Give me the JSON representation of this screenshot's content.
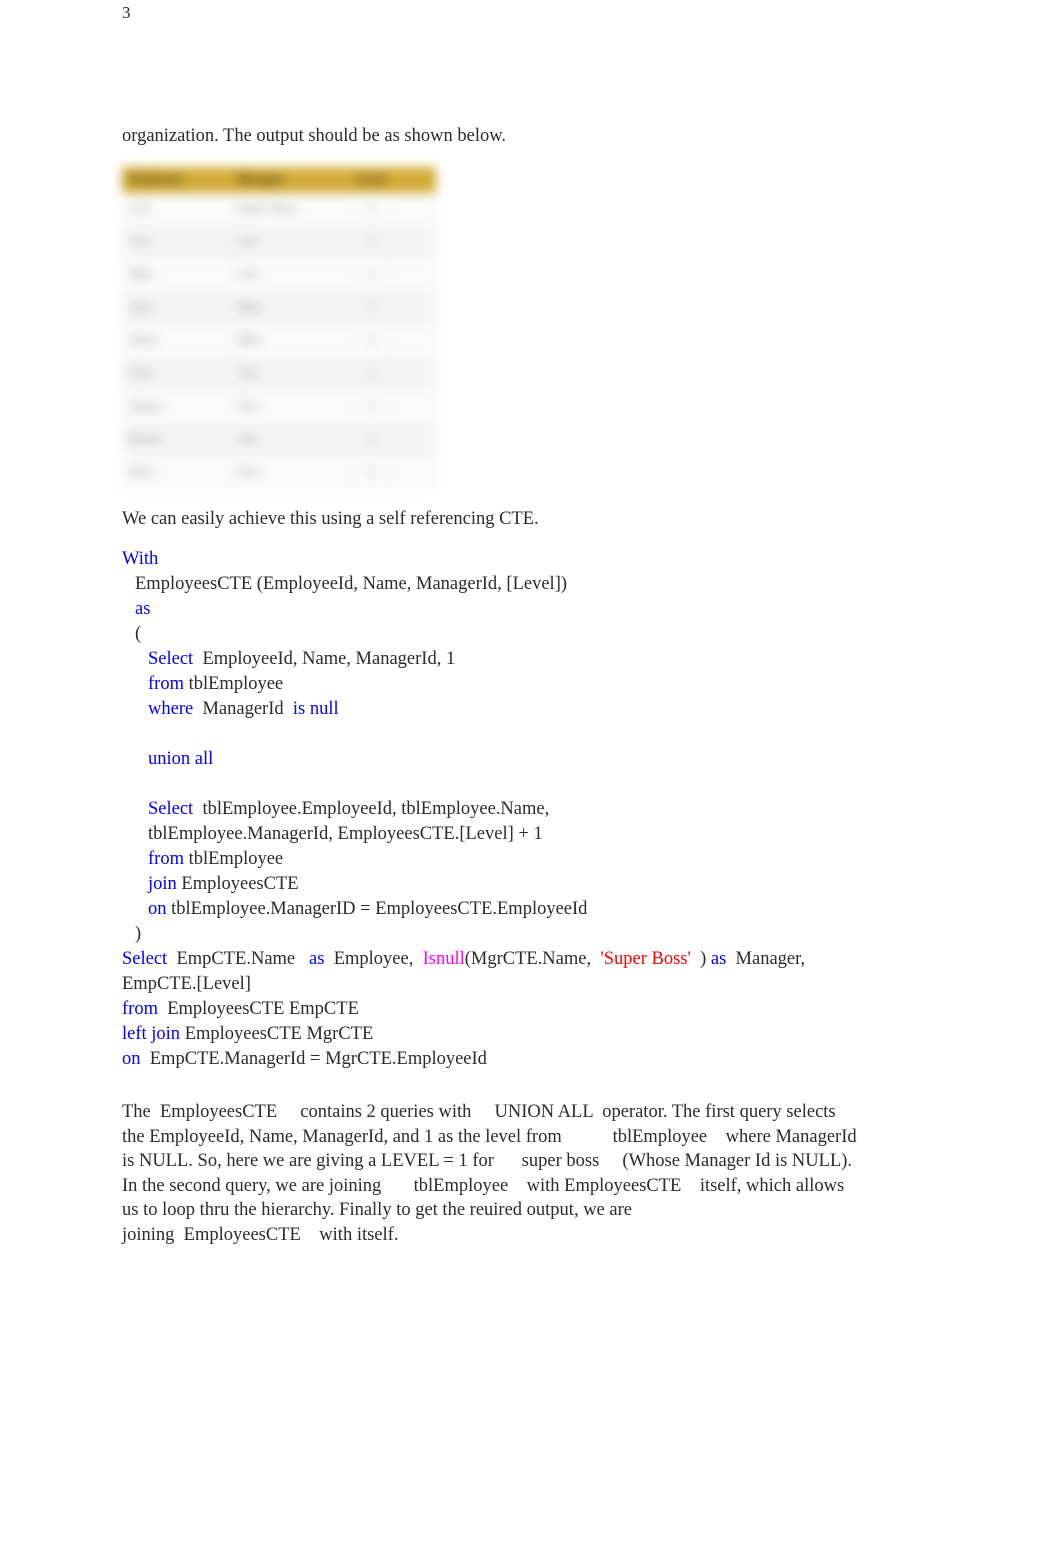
{
  "page": {
    "number": "3",
    "intro_line": "organization. The output should be as shown below."
  },
  "colors": {
    "keyword": "#0000ff",
    "function": "#ff00ff",
    "string": "#ff0000",
    "table_header_gold": "#cfa425",
    "body_text": "#2b2b2b"
  },
  "result_table": {
    "note": "table is rendered blurred/obscured in the screenshot; text is illegible",
    "columns": [
      "Employee",
      "Manager",
      "Level",
      ""
    ],
    "rows": [
      [
        "Luis",
        "Super Boss",
        "1",
        ""
      ],
      [
        "Tom",
        "Luis",
        "2",
        ""
      ],
      [
        "Mike",
        "Luis",
        "2",
        ""
      ],
      [
        "John",
        "Mike",
        "3",
        ""
      ],
      [
        "Steve",
        "Mike",
        "3",
        ""
      ],
      [
        "Pam",
        "Tom",
        "3",
        ""
      ],
      [
        "James",
        "Tom",
        "3",
        ""
      ],
      [
        "Martin",
        "Tom",
        "3",
        ""
      ],
      [
        "Ram",
        "Pam",
        "4",
        ""
      ]
    ]
  },
  "lead_in": "We can easily achieve this using a self referencing CTE.",
  "sql": {
    "lines": [
      {
        "indent": 0,
        "parts": [
          {
            "t": "With",
            "c": "kw"
          }
        ]
      },
      {
        "indent": 1,
        "parts": [
          {
            "t": "EmployeesCTE (EmployeeId, Name, ManagerId, [Level])",
            "c": ""
          }
        ]
      },
      {
        "indent": 1,
        "parts": [
          {
            "t": "as",
            "c": "kw"
          }
        ]
      },
      {
        "indent": 1,
        "parts": [
          {
            "t": "(",
            "c": ""
          }
        ]
      },
      {
        "indent": 2,
        "parts": [
          {
            "t": "Select",
            "c": "kw"
          },
          {
            "t": "  EmployeeId, Name, ManagerId, 1",
            "c": ""
          }
        ]
      },
      {
        "indent": 2,
        "parts": [
          {
            "t": "from",
            "c": "kw"
          },
          {
            "t": " tblEmployee",
            "c": ""
          }
        ]
      },
      {
        "indent": 2,
        "parts": [
          {
            "t": "where",
            "c": "kw"
          },
          {
            "t": "  ManagerId  ",
            "c": ""
          },
          {
            "t": "is null",
            "c": "kw"
          }
        ]
      },
      {
        "indent": 2,
        "parts": [
          {
            "t": "",
            "c": ""
          }
        ]
      },
      {
        "indent": 2,
        "parts": [
          {
            "t": "union all",
            "c": "kw"
          }
        ]
      },
      {
        "indent": 2,
        "parts": [
          {
            "t": "",
            "c": ""
          }
        ]
      },
      {
        "indent": 2,
        "parts": [
          {
            "t": "Select",
            "c": "kw"
          },
          {
            "t": "  tblEmployee.EmployeeId, tblEmployee.Name,",
            "c": ""
          }
        ]
      },
      {
        "indent": 2,
        "parts": [
          {
            "t": "tblEmployee.ManagerId, EmployeesCTE.[Level] + 1",
            "c": ""
          }
        ]
      },
      {
        "indent": 2,
        "parts": [
          {
            "t": "from",
            "c": "kw"
          },
          {
            "t": " tblEmployee",
            "c": ""
          }
        ]
      },
      {
        "indent": 2,
        "parts": [
          {
            "t": "join",
            "c": "kw"
          },
          {
            "t": " EmployeesCTE",
            "c": ""
          }
        ]
      },
      {
        "indent": 2,
        "parts": [
          {
            "t": "on",
            "c": "kw"
          },
          {
            "t": " tblEmployee.ManagerID = EmployeesCTE.EmployeeId",
            "c": ""
          }
        ]
      },
      {
        "indent": 1,
        "parts": [
          {
            "t": ")",
            "c": ""
          }
        ]
      },
      {
        "indent": 0,
        "parts": [
          {
            "t": "Select",
            "c": "kw"
          },
          {
            "t": "  EmpCTE.Name   ",
            "c": ""
          },
          {
            "t": "as",
            "c": "kw"
          },
          {
            "t": "  Employee,  ",
            "c": ""
          },
          {
            "t": "Isnull",
            "c": "fn"
          },
          {
            "t": "(MgrCTE.Name,  ",
            "c": ""
          },
          {
            "t": "'Super Boss'",
            "c": "str"
          },
          {
            "t": "  ) ",
            "c": ""
          },
          {
            "t": "as",
            "c": "kw"
          },
          {
            "t": "  Manager,",
            "c": ""
          }
        ]
      },
      {
        "indent": 0,
        "parts": [
          {
            "t": "EmpCTE.[Level]",
            "c": ""
          }
        ]
      },
      {
        "indent": 0,
        "parts": [
          {
            "t": "from",
            "c": "kw"
          },
          {
            "t": "  EmployeesCTE EmpCTE",
            "c": ""
          }
        ]
      },
      {
        "indent": 0,
        "parts": [
          {
            "t": "left join",
            "c": "kw"
          },
          {
            "t": " EmployeesCTE MgrCTE",
            "c": ""
          }
        ]
      },
      {
        "indent": 0,
        "parts": [
          {
            "t": "on",
            "c": "kw"
          },
          {
            "t": "  EmpCTE.ManagerId = MgrCTE.EmployeeId",
            "c": ""
          }
        ]
      }
    ]
  },
  "explanation": {
    "paragraph_lines": [
      "The  EmployeesCTE     contains 2 queries with     UNION ALL  operator. The first query selects",
      "the EmployeeId, Name, ManagerId, and 1 as the level from           tblEmployee    where ManagerId",
      "is NULL. So, here we are giving a LEVEL = 1 for      super boss     (Whose Manager Id is NULL).",
      "In the second query, we are joining       tblEmployee    with EmployeesCTE    itself, which allows",
      "us to loop thru the hierarchy. Finally to get the reuired output, we are",
      "joining  EmployeesCTE    with itself."
    ]
  }
}
